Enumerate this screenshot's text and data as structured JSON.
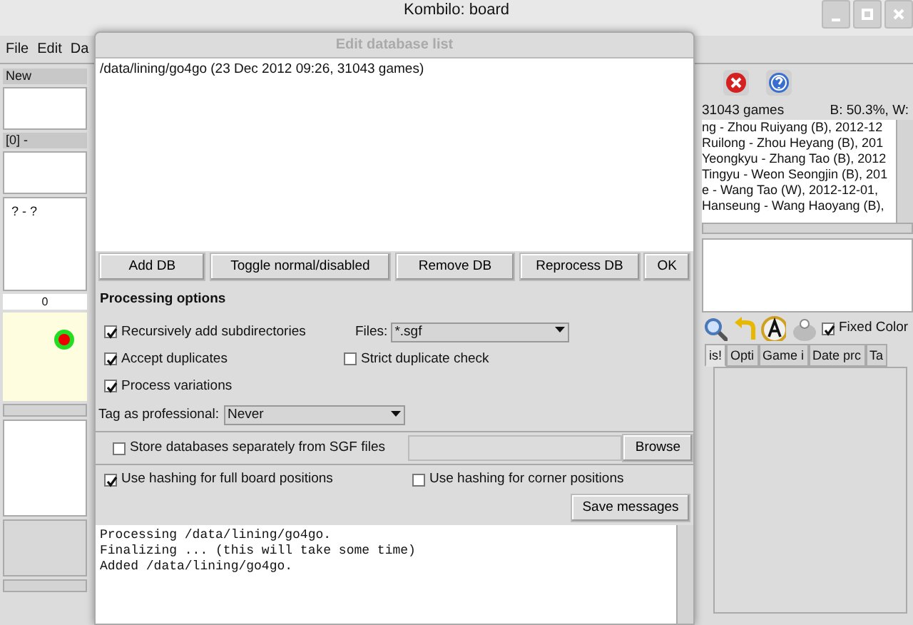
{
  "window": {
    "title": "Kombilo: board",
    "menu": [
      "File",
      "Edit",
      "Da"
    ]
  },
  "left_panel": {
    "header": "New",
    "variation_header": "[0]  -",
    "game_info": "? - ?",
    "move_number": "0"
  },
  "right_panel": {
    "game_count": "31043 games",
    "stats": "B: 50.3%, W:",
    "games": [
      "ng - Zhou Ruiyang (B), 2012-12",
      "Ruilong - Zhou Heyang (B), 201",
      "Yeongkyu - Zhang Tao (B), 2012",
      "Tingyu - Weon Seongjin (B), 201",
      "e - Wang Tao (W), 2012-12-01,",
      "Hanseung - Wang Haoyang (B),"
    ],
    "fixed_color": {
      "label": "Fixed Color",
      "checked": true
    },
    "tabs": [
      {
        "label": "is!",
        "selected": true
      },
      {
        "label": "Opti",
        "selected": false
      },
      {
        "label": "Game i",
        "selected": false
      },
      {
        "label": "Date prc",
        "selected": false
      },
      {
        "label": "Ta",
        "selected": false
      }
    ]
  },
  "dialog": {
    "title": "Edit database list",
    "databases": [
      "/data/lining/go4go (23 Dec 2012 09:26, 31043 games)"
    ],
    "buttons": [
      "Add DB",
      "Toggle normal/disabled",
      "Remove DB",
      "Reprocess DB",
      "OK"
    ],
    "section_title": "Processing options",
    "recursive": {
      "label": "Recursively add subdirectories",
      "checked": true
    },
    "files_label": "Files:",
    "files_value": "*.sgf",
    "accept_duplicates": {
      "label": "Accept duplicates",
      "checked": true
    },
    "strict_check": {
      "label": "Strict duplicate check",
      "checked": false
    },
    "process_variations": {
      "label": "Process variations",
      "checked": true
    },
    "tag_label": "Tag as professional:",
    "tag_value": "Never",
    "store_separately": {
      "label": "Store databases separately from SGF files",
      "checked": false
    },
    "browse": "Browse",
    "hash_full": {
      "label": "Use hashing for full board positions",
      "checked": true
    },
    "hash_corner": {
      "label": "Use hashing for corner positions",
      "checked": false
    },
    "save_messages": "Save messages",
    "messages": [
      "Processing /data/lining/go4go.",
      "Finalizing ... (this will take some time)",
      "Added /data/lining/go4go."
    ]
  }
}
